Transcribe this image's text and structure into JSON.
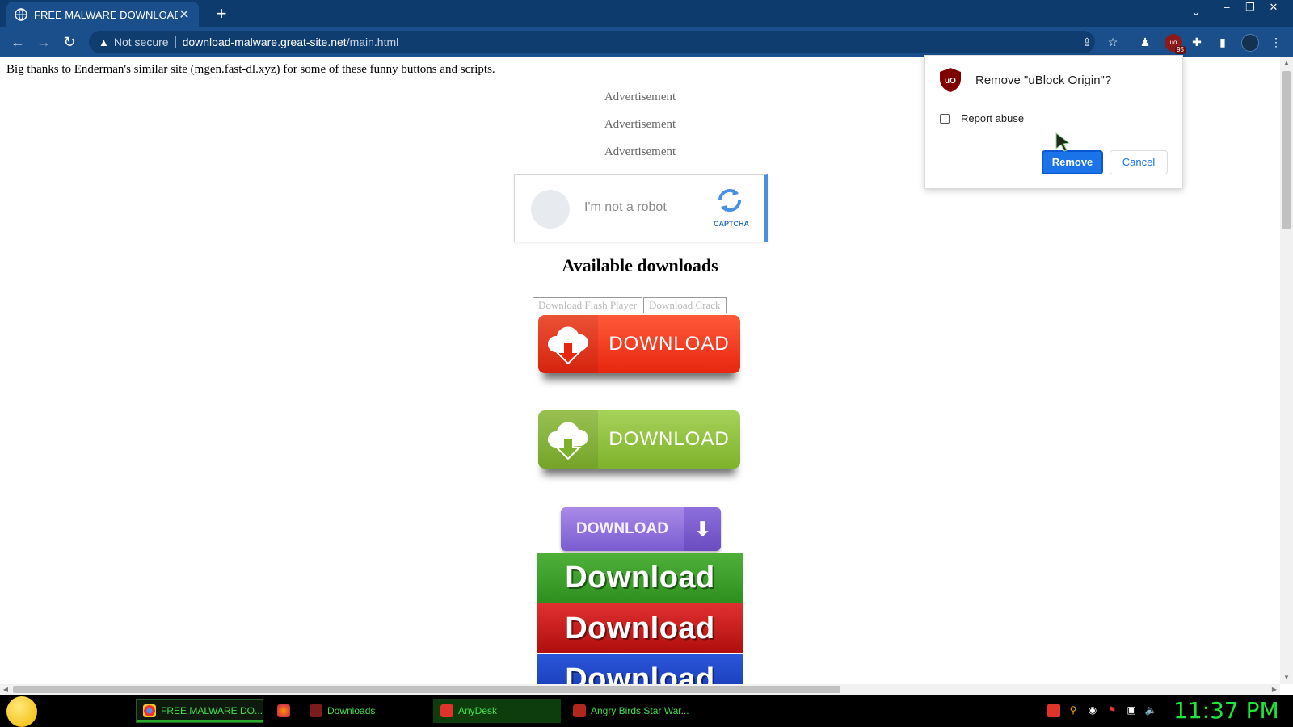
{
  "browser": {
    "tab_title": "FREE MALWARE DOWNLOAD",
    "url_security": "Not secure",
    "url_host": "download-malware.great-site.net",
    "url_path": "/main.html",
    "ublock_count": "95"
  },
  "page": {
    "thanks": "Big thanks to Enderman's similar site (mgen.fast-dl.xyz) for some of these funny buttons and scripts.",
    "ads": [
      "Advertisement",
      "Advertisement",
      "Advertisement"
    ],
    "captcha": {
      "text": "I'm not a robot",
      "logo_label": "CAPTCHA"
    },
    "heading": "Available downloads",
    "small_buttons": [
      "Download Flash Player",
      "Download Crack"
    ],
    "download_buttons": {
      "red": "DOWNLOAD",
      "green": "DOWNLOAD",
      "purple": "DOWNLOAD",
      "big_green": "Download",
      "big_red": "Download",
      "big_blue": "Download"
    }
  },
  "popup": {
    "title": "Remove \"uBlock Origin\"?",
    "checkbox_label": "Report abuse",
    "remove_label": "Remove",
    "cancel_label": "Cancel"
  },
  "taskbar": {
    "items": [
      "FREE MALWARE DO...",
      "Downloads",
      "AnyDesk",
      "Angry Birds Star War..."
    ],
    "clock": "11:37 PM"
  },
  "colors": {
    "chrome_frame": "#0d3b6e",
    "toolbar": "#1a4f8c",
    "accent_blue": "#1a73e8",
    "clock_green": "#1ee63a"
  }
}
